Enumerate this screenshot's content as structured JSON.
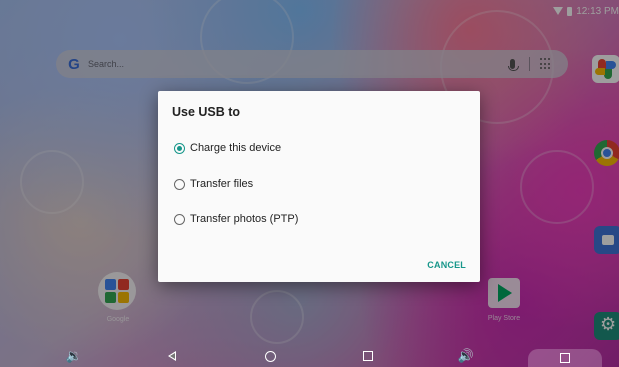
{
  "status_bar": {
    "time": "12:13 PM",
    "icons": [
      "wifi-icon",
      "battery-icon"
    ]
  },
  "search": {
    "placeholder": "Search...",
    "logo": "G"
  },
  "dialog": {
    "title": "Use USB to",
    "options": [
      {
        "label": "Charge this device",
        "selected": true
      },
      {
        "label": "Transfer files",
        "selected": false
      },
      {
        "label": "Transfer photos (PTP)",
        "selected": false
      }
    ],
    "cancel_label": "CANCEL"
  },
  "home": {
    "folder_label": "Google",
    "play_store_label": "Play Store",
    "dock_icons": [
      "photos-icon",
      "chrome-icon",
      "camera-icon",
      "settings-icon"
    ]
  },
  "nav": {
    "icons": [
      "volume-down-icon",
      "back-icon",
      "home-icon",
      "recents-icon",
      "volume-up-icon",
      "screenshot-icon"
    ]
  },
  "colors": {
    "accent": "#16968a"
  }
}
